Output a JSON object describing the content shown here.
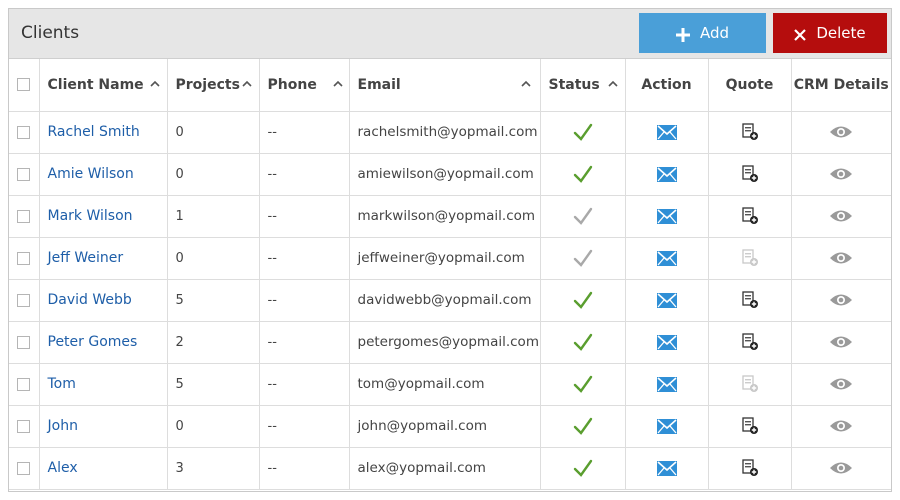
{
  "header": {
    "title": "Clients",
    "add_label": "Add",
    "delete_label": "Delete"
  },
  "columns": {
    "client_name": "Client Name",
    "projects": "Projects",
    "phone": "Phone",
    "email": "Email",
    "status": "Status",
    "action": "Action",
    "quote": "Quote",
    "crm": "CRM Details"
  },
  "colors": {
    "accent_blue": "#4a9fd8",
    "delete_red": "#b50d0d",
    "link_blue": "#1e5ea8",
    "status_active": "#5a9e2f",
    "status_inactive": "#a9a9a9"
  },
  "rows": [
    {
      "name": "Rachel Smith",
      "projects": "0",
      "phone": "--",
      "email": "rachelsmith@yopmail.com",
      "status": "active",
      "quote": "enabled"
    },
    {
      "name": "Amie Wilson",
      "projects": "0",
      "phone": "--",
      "email": "amiewilson@yopmail.com",
      "status": "active",
      "quote": "enabled"
    },
    {
      "name": "Mark Wilson",
      "projects": "1",
      "phone": "--",
      "email": "markwilson@yopmail.com",
      "status": "inactive",
      "quote": "enabled"
    },
    {
      "name": "Jeff Weiner",
      "projects": "0",
      "phone": "--",
      "email": "jeffweiner@yopmail.com",
      "status": "inactive",
      "quote": "disabled"
    },
    {
      "name": "David Webb",
      "projects": "5",
      "phone": "--",
      "email": "davidwebb@yopmail.com",
      "status": "active",
      "quote": "enabled"
    },
    {
      "name": "Peter Gomes",
      "projects": "2",
      "phone": "--",
      "email": "petergomes@yopmail.com",
      "status": "active",
      "quote": "enabled"
    },
    {
      "name": "Tom",
      "projects": "5",
      "phone": "--",
      "email": "tom@yopmail.com",
      "status": "active",
      "quote": "disabled"
    },
    {
      "name": "John",
      "projects": "0",
      "phone": "--",
      "email": "john@yopmail.com",
      "status": "active",
      "quote": "enabled"
    },
    {
      "name": "Alex",
      "projects": "3",
      "phone": "--",
      "email": "alex@yopmail.com",
      "status": "active",
      "quote": "enabled"
    }
  ],
  "icons": {
    "status": "checkmark-icon",
    "action": "envelope-icon",
    "quote": "quote-add-icon",
    "crm": "eye-icon",
    "sort": "chevron-up-icon"
  }
}
